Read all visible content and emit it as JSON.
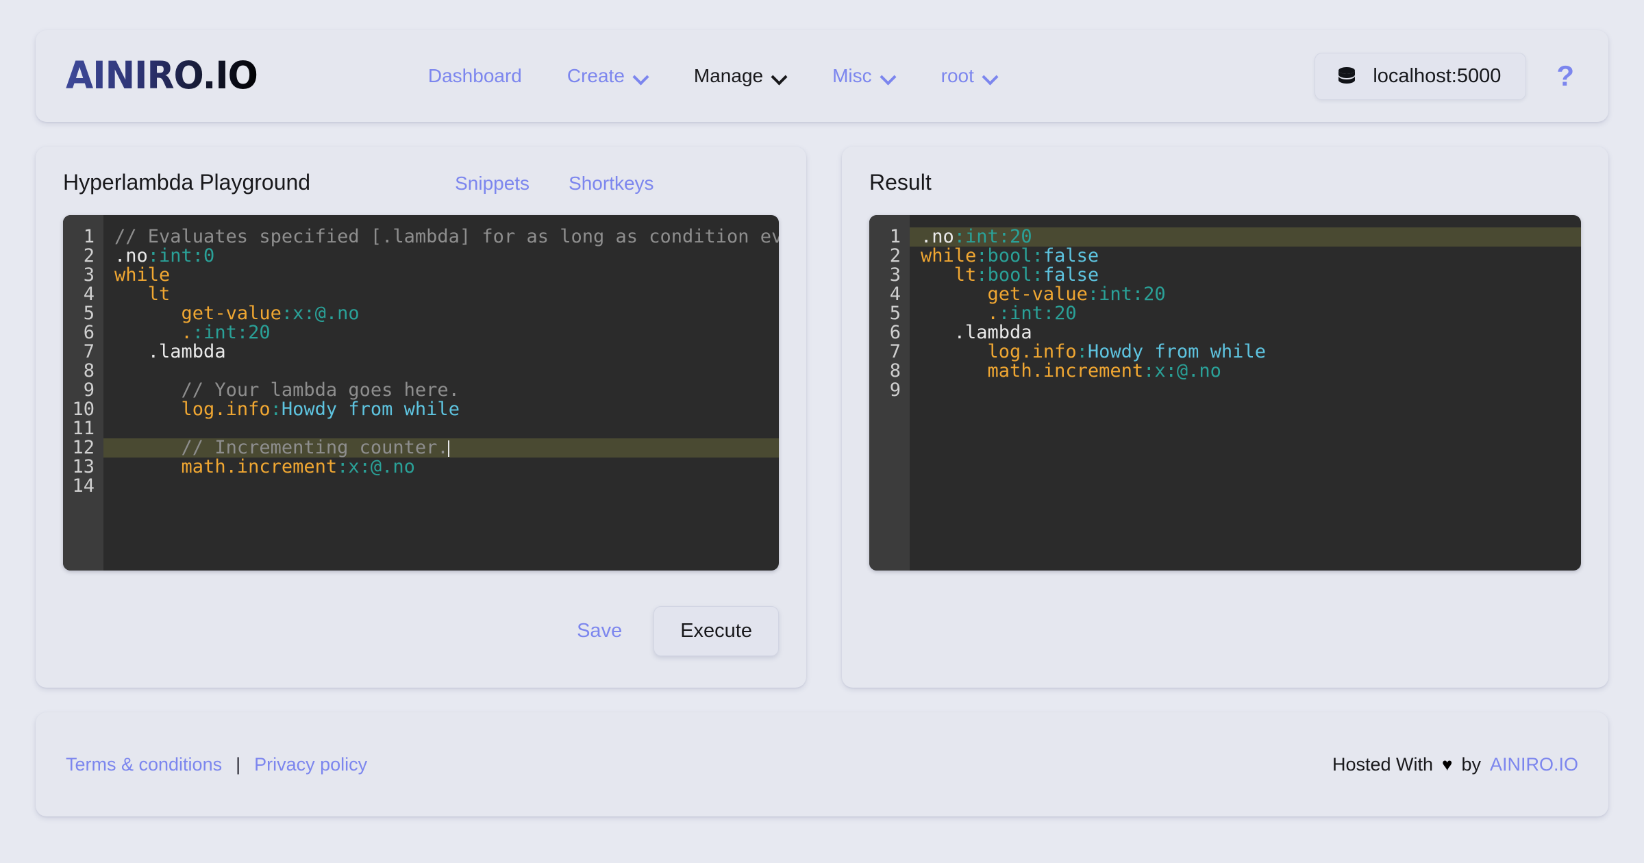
{
  "brand": {
    "logo": "AINIRO.IO",
    "accent": "#7c86ee",
    "page_bg": "#e7e9f1",
    "card_bg": "#e5e7ef"
  },
  "navbar": {
    "items": [
      {
        "label": "Dashboard",
        "has_caret": false,
        "active": false
      },
      {
        "label": "Create",
        "has_caret": true,
        "active": false
      },
      {
        "label": "Manage",
        "has_caret": true,
        "active": true
      },
      {
        "label": "Misc",
        "has_caret": true,
        "active": false
      },
      {
        "label": "root",
        "has_caret": true,
        "active": false
      }
    ],
    "database_chip": {
      "icon": "database-icon",
      "label": "localhost:5000"
    },
    "help": {
      "icon": "help-question-icon",
      "label": "?"
    }
  },
  "playground": {
    "title": "Hyperlambda Playground",
    "links": [
      {
        "label": "Snippets"
      },
      {
        "label": "Shortkeys"
      }
    ],
    "editor": {
      "line_count": 14,
      "active_line": 12,
      "lines": [
        {
          "n": 1,
          "tokens": [
            {
              "t": "comment",
              "v": "// Evaluates specified [.lambda] for as long as condition eva"
            }
          ]
        },
        {
          "n": 2,
          "tokens": [
            {
              "t": "name",
              "v": ".no"
            },
            {
              "t": "val",
              "v": ":int:0"
            }
          ]
        },
        {
          "n": 3,
          "tokens": [
            {
              "t": "key",
              "v": "while"
            }
          ]
        },
        {
          "n": 4,
          "tokens": [
            {
              "t": "plain",
              "v": "   "
            },
            {
              "t": "key",
              "v": "lt"
            }
          ]
        },
        {
          "n": 5,
          "tokens": [
            {
              "t": "plain",
              "v": "      "
            },
            {
              "t": "key",
              "v": "get-value"
            },
            {
              "t": "val",
              "v": ":x:@.no"
            }
          ]
        },
        {
          "n": 6,
          "tokens": [
            {
              "t": "plain",
              "v": "      "
            },
            {
              "t": "key",
              "v": "."
            },
            {
              "t": "val",
              "v": ":int:20"
            }
          ]
        },
        {
          "n": 7,
          "tokens": [
            {
              "t": "plain",
              "v": "   "
            },
            {
              "t": "name",
              "v": ".lambda"
            }
          ]
        },
        {
          "n": 8,
          "tokens": [
            {
              "t": "plain",
              "v": ""
            }
          ]
        },
        {
          "n": 9,
          "tokens": [
            {
              "t": "plain",
              "v": "      "
            },
            {
              "t": "comment",
              "v": "// Your lambda goes here."
            }
          ]
        },
        {
          "n": 10,
          "tokens": [
            {
              "t": "plain",
              "v": "      "
            },
            {
              "t": "key",
              "v": "log.info"
            },
            {
              "t": "colon",
              "v": ":"
            },
            {
              "t": "str",
              "v": "Howdy from while"
            }
          ]
        },
        {
          "n": 11,
          "tokens": [
            {
              "t": "plain",
              "v": ""
            }
          ]
        },
        {
          "n": 12,
          "tokens": [
            {
              "t": "plain",
              "v": "      "
            },
            {
              "t": "comment",
              "v": "// Incrementing counter."
            },
            {
              "t": "caret",
              "v": ""
            }
          ]
        },
        {
          "n": 13,
          "tokens": [
            {
              "t": "plain",
              "v": "      "
            },
            {
              "t": "key",
              "v": "math.increment"
            },
            {
              "t": "val",
              "v": ":x:@.no"
            }
          ]
        },
        {
          "n": 14,
          "tokens": [
            {
              "t": "plain",
              "v": ""
            }
          ]
        }
      ]
    },
    "save_label": "Save",
    "execute_label": "Execute"
  },
  "result": {
    "title": "Result",
    "editor": {
      "line_count": 9,
      "active_line": 1,
      "lines": [
        {
          "n": 1,
          "tokens": [
            {
              "t": "name",
              "v": ".no"
            },
            {
              "t": "val",
              "v": ":int:20"
            }
          ]
        },
        {
          "n": 2,
          "tokens": [
            {
              "t": "key",
              "v": "while"
            },
            {
              "t": "colon",
              "v": ":"
            },
            {
              "t": "val",
              "v": "bool"
            },
            {
              "t": "colon",
              "v": ":"
            },
            {
              "t": "str",
              "v": "false"
            }
          ]
        },
        {
          "n": 3,
          "tokens": [
            {
              "t": "plain",
              "v": "   "
            },
            {
              "t": "key",
              "v": "lt"
            },
            {
              "t": "colon",
              "v": ":"
            },
            {
              "t": "val",
              "v": "bool"
            },
            {
              "t": "colon",
              "v": ":"
            },
            {
              "t": "str",
              "v": "false"
            }
          ]
        },
        {
          "n": 4,
          "tokens": [
            {
              "t": "plain",
              "v": "      "
            },
            {
              "t": "key",
              "v": "get-value"
            },
            {
              "t": "val",
              "v": ":int:20"
            }
          ]
        },
        {
          "n": 5,
          "tokens": [
            {
              "t": "plain",
              "v": "      "
            },
            {
              "t": "key",
              "v": "."
            },
            {
              "t": "val",
              "v": ":int:20"
            }
          ]
        },
        {
          "n": 6,
          "tokens": [
            {
              "t": "plain",
              "v": "   "
            },
            {
              "t": "name",
              "v": ".lambda"
            }
          ]
        },
        {
          "n": 7,
          "tokens": [
            {
              "t": "plain",
              "v": "      "
            },
            {
              "t": "key",
              "v": "log.info"
            },
            {
              "t": "colon",
              "v": ":"
            },
            {
              "t": "str",
              "v": "Howdy from while"
            }
          ]
        },
        {
          "n": 8,
          "tokens": [
            {
              "t": "plain",
              "v": "      "
            },
            {
              "t": "key",
              "v": "math.increment"
            },
            {
              "t": "val",
              "v": ":x:@.no"
            }
          ]
        },
        {
          "n": 9,
          "tokens": [
            {
              "t": "plain",
              "v": ""
            }
          ]
        }
      ]
    }
  },
  "footer": {
    "terms_label": "Terms & conditions",
    "separator": "|",
    "privacy_label": "Privacy policy",
    "hosted_prefix": "Hosted With",
    "heart": "♥",
    "hosted_by": "by",
    "hosted_brand": "AINIRO.IO"
  }
}
